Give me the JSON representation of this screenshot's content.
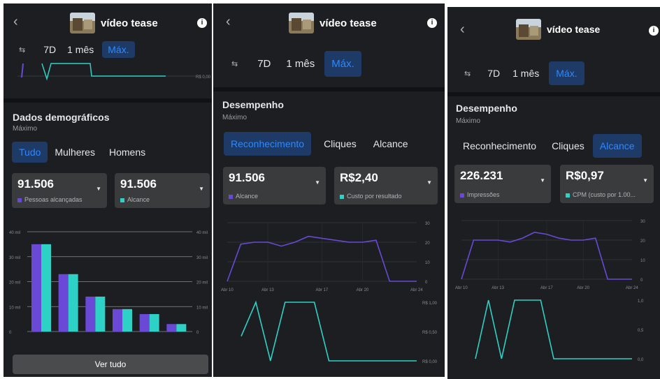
{
  "colors": {
    "purple": "#6949d6",
    "teal": "#2ed1c5",
    "accent": "#2d88ff",
    "panel": "#1c1e21",
    "card": "#3a3b3c"
  },
  "icons": {
    "back": "chevron-left-icon",
    "info": "info-icon",
    "filter": "filter-icon",
    "dropdown": "caret-down-icon"
  },
  "header": {
    "title": "vídeo tease",
    "back_glyph": "‹",
    "info_glyph": "i"
  },
  "range": {
    "filter_glyph": "⇆",
    "options": [
      "7D",
      "1 mês",
      "Máx."
    ],
    "selected": "Máx."
  },
  "panel1": {
    "axis_right_label": "R$ 0,00",
    "demo_title": "Dados demográficos",
    "demo_sub": "Máximo",
    "segments": [
      "Tudo",
      "Mulheres",
      "Homens"
    ],
    "selected_segment": "Tudo",
    "metric1": {
      "value": "91.506",
      "label": "Pessoas alcançadas"
    },
    "metric2": {
      "value": "91.506",
      "label": "Alcance"
    },
    "ver_tudo": "Ver tudo",
    "chart_data": {
      "type": "bar",
      "categories": [
        "",
        "",
        "",
        "",
        "",
        ""
      ],
      "series": [
        {
          "name": "Pessoas alcançadas",
          "values": [
            35000,
            23000,
            14000,
            9000,
            7000,
            3000
          ]
        },
        {
          "name": "Alcance",
          "values": [
            35000,
            23000,
            14000,
            9000,
            7000,
            3000
          ]
        }
      ],
      "ylim": [
        0,
        40000
      ],
      "left_ticks": [
        "0",
        "10 mil",
        "20 mil",
        "30 mil",
        "40 mil"
      ],
      "right_ticks": [
        "0",
        "10 mil",
        "20 mil",
        "30 mil",
        "40 mil"
      ]
    }
  },
  "panel2": {
    "perf_title": "Desempenho",
    "perf_sub": "Máximo",
    "segments": [
      "Reconhecimento",
      "Cliques",
      "Alcance"
    ],
    "selected_segment": "Reconhecimento",
    "metric1": {
      "value": "91.506",
      "label": "Alcance"
    },
    "metric2": {
      "value": "R$2,40",
      "label": "Custo por resultado"
    },
    "chart_data": [
      {
        "type": "line",
        "x": [
          "Abr 10",
          "",
          "",
          "Abr 13",
          "",
          "",
          "",
          "Abr 17",
          "",
          "",
          "Abr 20",
          "",
          "",
          "",
          "Abr 24"
        ],
        "series": [
          {
            "name": "Alcance",
            "values": [
              0,
              19,
              20,
              20,
              18,
              20,
              23,
              22,
              21,
              20,
              20,
              21,
              0,
              0,
              0
            ]
          }
        ],
        "ylim": [
          0,
          30
        ],
        "y_ticks": [
          "0",
          "10",
          "20",
          "30"
        ]
      },
      {
        "type": "line",
        "series": [
          {
            "name": "Custo por resultado",
            "values": [
              0.42,
              1.0,
              0.0,
              1.0,
              1.0,
              1.0,
              0.0,
              0.0,
              0.0,
              0.0,
              0.0,
              0.0,
              0.0
            ]
          }
        ],
        "ylim": [
          0,
          1
        ],
        "y_ticks": [
          "R$ 0,00",
          "R$ 0,50",
          "R$ 1,00"
        ]
      }
    ]
  },
  "panel3": {
    "perf_title": "Desempenho",
    "perf_sub": "Máximo",
    "segments": [
      "Reconhecimento",
      "Cliques",
      "Alcance"
    ],
    "selected_segment": "Alcance",
    "metric1": {
      "value": "226.231",
      "label": "Impressões"
    },
    "metric2": {
      "value": "R$0,97",
      "label": "CPM (custo por 1.00..."
    },
    "chart_data": [
      {
        "type": "line",
        "x": [
          "Abr 10",
          "",
          "",
          "Abr 13",
          "",
          "",
          "",
          "Abr 17",
          "",
          "",
          "Abr 20",
          "",
          "",
          "",
          "Abr 24"
        ],
        "series": [
          {
            "name": "Impressões",
            "values": [
              0,
              20,
              20,
              20,
              19,
              21,
              24,
              23,
              21,
              20,
              20,
              21,
              0,
              0,
              0
            ]
          }
        ],
        "ylim": [
          0,
          30
        ],
        "y_ticks": [
          "0",
          "10",
          "20",
          "30"
        ]
      },
      {
        "type": "line",
        "series": [
          {
            "name": "CPM",
            "values": [
              0.0,
              1.0,
              0.0,
              1.0,
              1.0,
              1.0,
              0.0,
              0.0,
              0.0,
              0.0,
              0.0,
              0.0,
              0.0
            ]
          }
        ],
        "ylim": [
          0,
          1
        ],
        "y_ticks": [
          "0,0",
          "0,5",
          "1,0"
        ]
      }
    ]
  }
}
